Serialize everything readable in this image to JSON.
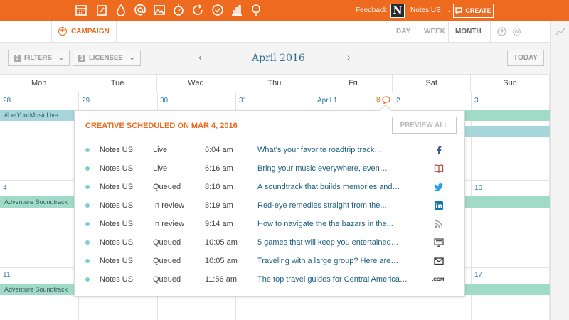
{
  "topbar": {
    "feedback": "Feedback",
    "logo_letter": "N",
    "account": "Notes US",
    "create_label": "CREATE",
    "tools": [
      "calendar-icon",
      "edit-icon",
      "drop-icon",
      "at-icon",
      "image-icon",
      "stopwatch-icon",
      "refresh-icon",
      "check-icon",
      "bar-chart-icon",
      "lightbulb-icon"
    ]
  },
  "subbar": {
    "campaign_label": "CAMPAIGN",
    "views": [
      {
        "label": "DAY",
        "active": false
      },
      {
        "label": "WEEK",
        "active": false
      },
      {
        "label": "MONTH",
        "active": true
      }
    ]
  },
  "toolbar": {
    "filters": {
      "count": "0",
      "label": "FILTERS"
    },
    "licenses": {
      "count": "1",
      "label": "LICENSES"
    },
    "month": "April 2016",
    "today_label": "TODAY"
  },
  "calendar": {
    "weekdays": [
      "Mon",
      "Tue",
      "Wed",
      "Thu",
      "Fri",
      "Sat",
      "Sun"
    ],
    "week1": [
      "28",
      "29",
      "30",
      "31",
      "April 1",
      "2",
      "3"
    ],
    "week2_visible": [
      "4",
      "10"
    ],
    "week3_visible": [
      "11",
      "17"
    ],
    "fri_count": "8",
    "events": {
      "music_live": "#LetYourMusicLive",
      "adventure_1": "Adventure Soundtrack",
      "adventure_2": "Adventure Soundtrack"
    }
  },
  "popover": {
    "title": "CREATIVE SCHEDULED ON MAR 4, 2016",
    "preview_all": "PREVIEW ALL",
    "rows": [
      {
        "account": "Notes US",
        "status": "Live",
        "time": "6:04 am",
        "title": "What’s your favorite roadtrip track…",
        "network": "facebook-icon"
      },
      {
        "account": "Notes US",
        "status": "Live",
        "time": "6:16 am",
        "title": "Bring your music everywhere, even…",
        "network": "book-icon"
      },
      {
        "account": "Notes US",
        "status": "Queued",
        "time": "8:10 am",
        "title": "A soundtrack that builds memories and…",
        "network": "twitter-icon"
      },
      {
        "account": "Notes US",
        "status": "In review",
        "time": "8:19 am",
        "title": "Red-eye remedies straight from the...",
        "network": "linkedin-icon"
      },
      {
        "account": "Notes US",
        "status": "In review",
        "time": "9:14 am",
        "title": "How to navigate the the bazars in the...",
        "network": "rss-icon"
      },
      {
        "account": "Notes US",
        "status": "Queued",
        "time": "10:05 am",
        "title": "5 games that will keep you entertained…",
        "network": "monitor-icon"
      },
      {
        "account": "Notes US",
        "status": "Queued",
        "time": "10:05 am",
        "title": "Traveling with a large group? Here are…",
        "network": "mail-icon"
      },
      {
        "account": "Notes US",
        "status": "Queued",
        "time": "11:56 am",
        "title": "The top travel guides for Central America…",
        "network": "dotcom-icon",
        "network_text": ".COM"
      }
    ]
  }
}
